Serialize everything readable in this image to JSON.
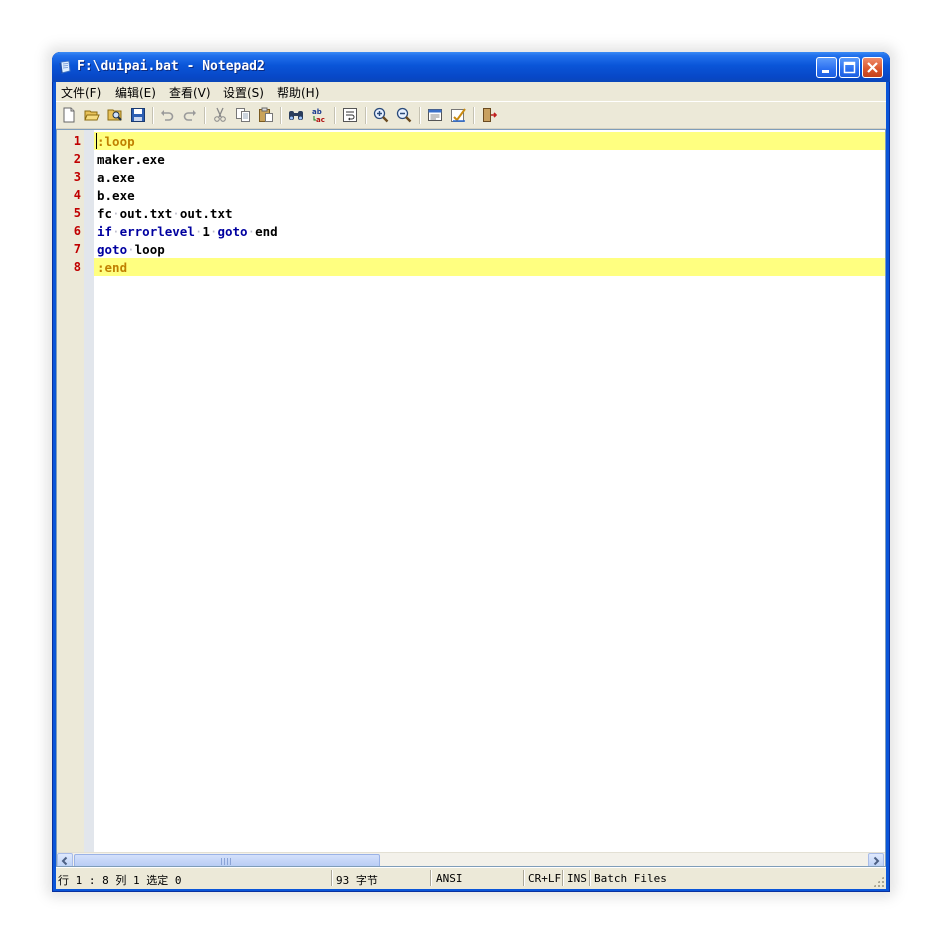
{
  "window": {
    "title": "F:\\duipai.bat - Notepad2"
  },
  "menu": [
    {
      "label": "文件(F)"
    },
    {
      "label": "编辑(E)"
    },
    {
      "label": "查看(V)"
    },
    {
      "label": "设置(S)"
    },
    {
      "label": "帮助(H)"
    }
  ],
  "toolbar": {
    "icons": [
      "new-file-icon",
      "open-folder-icon",
      "browse-icon",
      "save-icon",
      "undo-icon",
      "redo-icon",
      "cut-icon",
      "copy-icon",
      "paste-icon",
      "find-icon",
      "replace-icon",
      "word-wrap-icon",
      "zoom-in-icon",
      "zoom-out-icon",
      "scheme-icon",
      "customize-icon",
      "exit-icon"
    ]
  },
  "editor": {
    "lines": [
      {
        "number": "1",
        "text": ":loop"
      },
      {
        "number": "2",
        "text": "maker.exe"
      },
      {
        "number": "3",
        "text": "a.exe"
      },
      {
        "number": "4",
        "text": "b.exe"
      },
      {
        "number": "5",
        "text": "fc out.txt out.txt"
      },
      {
        "number": "6",
        "text": "if errorlevel 1 goto end"
      },
      {
        "number": "7",
        "text": "goto loop"
      },
      {
        "number": "8",
        "text": ":end"
      }
    ],
    "highlight_color": "#ffff80",
    "line_number_color": "#c00000",
    "keyword_color": "#0000a0",
    "label_color": "#c08000"
  },
  "status": {
    "position": "行 1 : 8   列 1   选定 0",
    "size": "93 字节",
    "encoding": "ANSI",
    "line_endings": "CR+LF",
    "mode": "INS",
    "lexer": "Batch Files"
  }
}
